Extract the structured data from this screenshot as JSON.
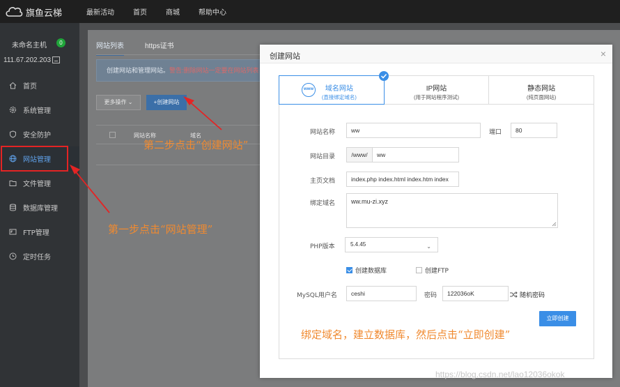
{
  "brand": {
    "name": "旗鱼云梯"
  },
  "topnav": {
    "items": [
      "最新活动",
      "首页",
      "商城",
      "帮助中心"
    ]
  },
  "sidebar": {
    "host_name": "未命名主机",
    "host_badge": "0",
    "host_ip": "111.67.202.203",
    "items": [
      {
        "label": "首页",
        "icon": "home-icon"
      },
      {
        "label": "系统管理",
        "icon": "gear-icon"
      },
      {
        "label": "安全防护",
        "icon": "shield-icon"
      },
      {
        "label": "网站管理",
        "icon": "globe-icon"
      },
      {
        "label": "文件管理",
        "icon": "folder-icon"
      },
      {
        "label": "数据库管理",
        "icon": "database-icon"
      },
      {
        "label": "FTP管理",
        "icon": "ftp-icon"
      },
      {
        "label": "定时任务",
        "icon": "clock-icon"
      }
    ],
    "active_index": 3
  },
  "main": {
    "tabs": [
      "网站列表",
      "https证书"
    ],
    "notice_prefix": "创建网站和管理网站。",
    "notice_warn": "警告:删除网站一定要在网站列表",
    "more_button": "更多操作 ⌄",
    "create_button": "+创建网站",
    "table_headers": [
      "网站名称",
      "域名"
    ]
  },
  "annotations": {
    "step1": "第一步点击“网站管理”",
    "step2": "第二步点击“创建网站”",
    "step3": "绑定域名，建立数据库，然后点击“立即创建”"
  },
  "modal": {
    "title": "创建网站",
    "close": "×",
    "type_tabs": [
      {
        "label": "域名网站",
        "sub": "(直接绑定域名)",
        "icon_text": "www"
      },
      {
        "label": "IP网站",
        "sub": "(用于网站程序测试)"
      },
      {
        "label": "静态网站",
        "sub": "(纯页面网站)"
      }
    ],
    "form": {
      "site_name_label": "网站名称",
      "site_name_value": "ww",
      "port_label": "端口",
      "port_value": "80",
      "dir_label": "网站目录",
      "dir_prefix": "/www/",
      "dir_value": "ww",
      "index_label": "主页文档",
      "index_value": "index.php index.html index.htm index",
      "domain_label": "绑定域名",
      "domain_value": "ww.mu-zi.xyz",
      "php_label": "PHP版本",
      "php_value": "5.4.45",
      "create_db_label": "创建数据库",
      "create_db_checked": true,
      "create_ftp_label": "创建FTP",
      "create_ftp_checked": false,
      "mysql_user_label": "MySQL用户名",
      "mysql_user_value": "ceshi",
      "password_label": "密码",
      "password_value": "122036oK",
      "random_pwd_label": "随机密码",
      "submit_label": "立即创建"
    }
  },
  "watermark": "https://blog.csdn.net/lao12036okok",
  "colors": {
    "accent": "#3a8ee6",
    "annotation": "#f08a30",
    "highlight": "#e42424",
    "success": "#20a53a"
  }
}
